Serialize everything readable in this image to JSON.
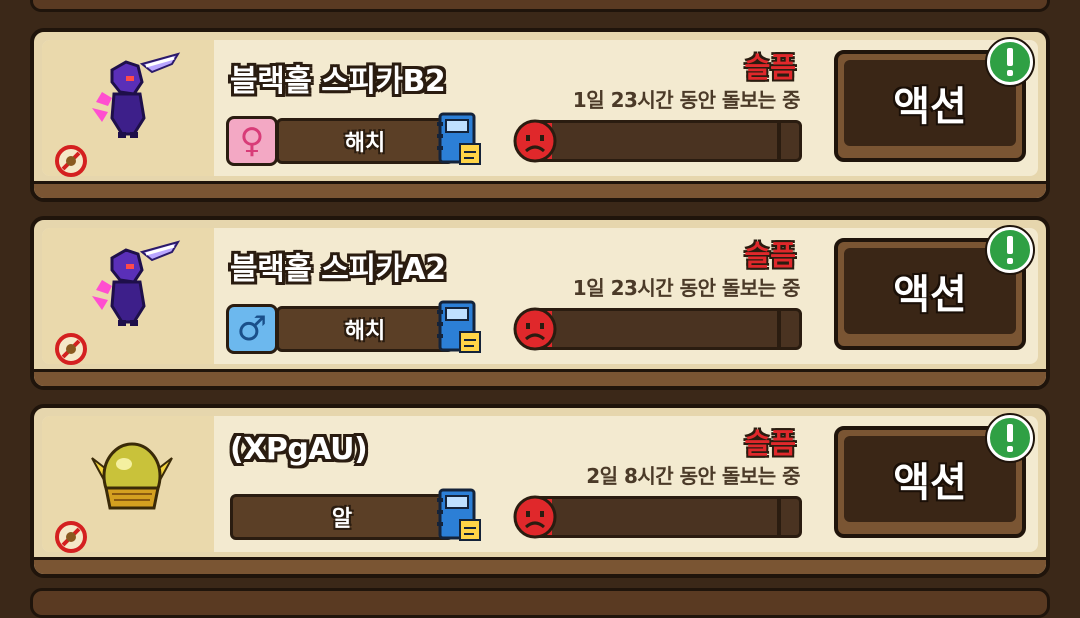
{
  "pets": [
    {
      "name": "블랙홀 스피카B2",
      "gender": "female",
      "gender_symbol": "♀",
      "stage": "해치",
      "mood": "슬픔",
      "care_time": "1일 23시간 동안 돌보는 중",
      "mood_level": 0.08,
      "action_label": "액션",
      "sprite_icon": "purple-dragon-sprite-icon"
    },
    {
      "name": "블랙홀 스피카A2",
      "gender": "male",
      "gender_symbol": "♂",
      "stage": "해치",
      "mood": "슬픔",
      "care_time": "1일 23시간 동안 돌보는 중",
      "mood_level": 0.08,
      "action_label": "액션",
      "sprite_icon": "purple-dragon-sprite-icon"
    },
    {
      "name": "(XPgAU)",
      "gender": "",
      "gender_symbol": "",
      "stage": "알",
      "mood": "슬픔",
      "care_time": "2일 8시간 동안 돌보는 중",
      "mood_level": 0.08,
      "action_label": "액션",
      "sprite_icon": "golden-egg-sprite-icon"
    }
  ],
  "colors": {
    "mood_sad": "#e0282b",
    "panel": "#f3ead0",
    "frame": "#1f140b",
    "female": "#f3a8c4",
    "male": "#6cb8ee"
  }
}
